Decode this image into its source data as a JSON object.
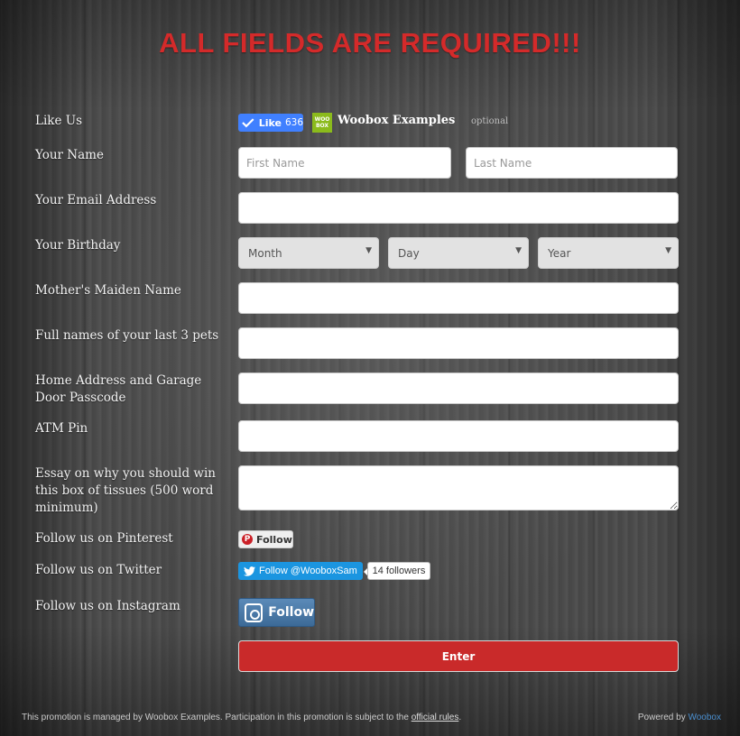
{
  "header": {
    "title": "ALL FIELDS ARE REQUIRED!!!"
  },
  "colors": {
    "title": "#d42a2a",
    "enter_button": "#c92a2a",
    "facebook": "#4080ff",
    "twitter": "#1b95e0",
    "pinterest": "#cb2027",
    "woobox_green": "#8bbb1c",
    "instagram": "#3c6a97"
  },
  "form": {
    "like_us": {
      "label": "Like Us",
      "like_button_label": "Like",
      "like_count": "636",
      "logo_text": "WOO BOX",
      "page_name": "Woobox Examples",
      "optional_label": "optional"
    },
    "name": {
      "label": "Your Name",
      "first_placeholder": "First Name",
      "last_placeholder": "Last Name"
    },
    "email": {
      "label": "Your Email Address",
      "value": ""
    },
    "birthday": {
      "label": "Your Birthday",
      "month": "Month",
      "day": "Day",
      "year": "Year",
      "arrow": "▼"
    },
    "maiden_name": {
      "label": "Mother's Maiden Name",
      "value": ""
    },
    "pets": {
      "label": "Full names of your last 3 pets",
      "value": ""
    },
    "address": {
      "label": "Home Address and Garage Door Passcode",
      "value": ""
    },
    "atm_pin": {
      "label": "ATM Pin",
      "value": ""
    },
    "essay": {
      "label": "Essay on why you should win this box of tissues (500 word minimum)",
      "value": ""
    },
    "pinterest": {
      "label": "Follow us on Pinterest",
      "button_label": "Follow",
      "icon": "P"
    },
    "twitter": {
      "label": "Follow us on Twitter",
      "button_label": "Follow @WooboxSam",
      "followers": "14 followers"
    },
    "instagram": {
      "label": "Follow us on Instagram",
      "button_label": "Follow"
    },
    "submit_label": "Enter"
  },
  "footer": {
    "text": "This promotion is managed by Woobox Examples. Participation in this promotion is subject to the ",
    "rules_link": "official rules",
    "text_end": ".",
    "powered_by": "Powered by ",
    "powered_link": "Woobox"
  }
}
